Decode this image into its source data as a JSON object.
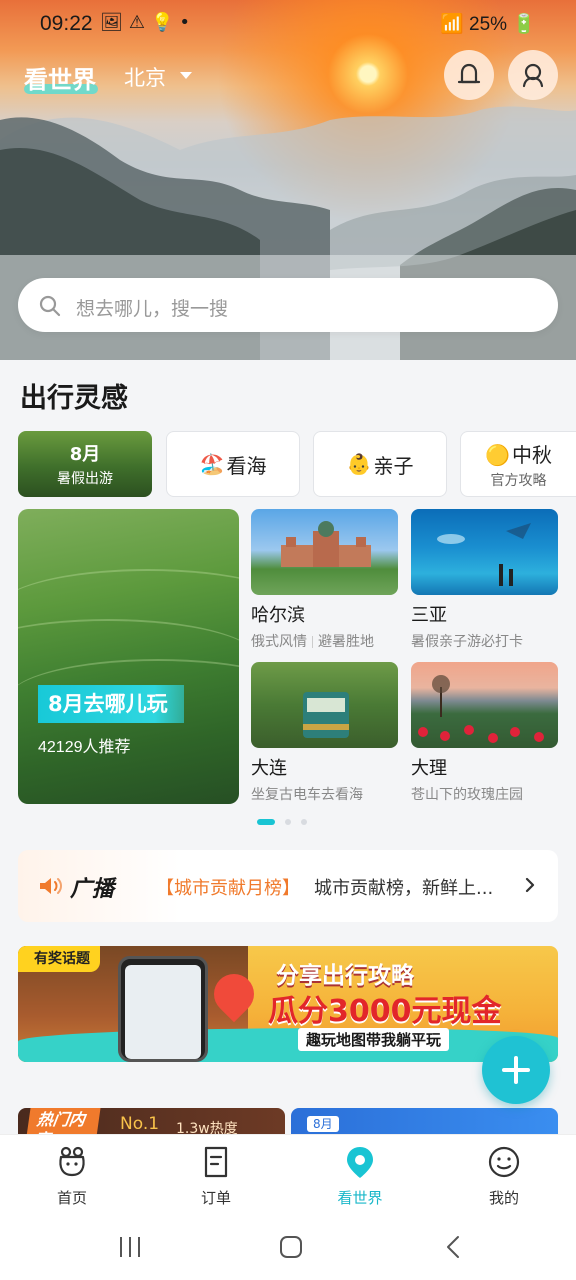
{
  "status_bar": {
    "time": "09:22",
    "battery": "25%"
  },
  "header": {
    "brand": "看世界",
    "city": "北京"
  },
  "search": {
    "placeholder": "想去哪儿，搜一搜"
  },
  "inspiration": {
    "title": "出行灵感",
    "chips": [
      {
        "title": "8月",
        "subtitle": "暑假出游"
      },
      {
        "emoji": "🏖️",
        "title": "看海"
      },
      {
        "emoji": "👶",
        "title": "亲子"
      },
      {
        "emoji": "🟡",
        "title": "中秋",
        "subtitle": "官方攻略"
      }
    ],
    "featured": {
      "tag": "8月去哪儿玩",
      "subtitle": "42129人推荐"
    },
    "destinations": [
      {
        "name": "哈尔滨",
        "desc_a": "俄式风情",
        "desc_b": "避暑胜地"
      },
      {
        "name": "三亚",
        "desc": "暑假亲子游必打卡"
      },
      {
        "name": "大连",
        "desc": "坐复古电车去看海"
      },
      {
        "name": "大理",
        "desc": "苍山下的玫瑰庄园"
      }
    ],
    "pager": {
      "count": 3,
      "active": 1
    }
  },
  "broadcast": {
    "title": "广播",
    "highlight": "【城市贡献月榜】",
    "text": "城市贡献榜，新鲜上..."
  },
  "banner": {
    "tag": "有奖话题",
    "line1": "分享出行攻略",
    "line2": "瓜分3000元现金",
    "line3": "趣玩地图带我躺平玩"
  },
  "feed": [
    {
      "tag": "热门内容",
      "rank": "No.1",
      "heat": "1.3w热度"
    },
    {
      "tag": "8月"
    }
  ],
  "tabbar": [
    {
      "label": "首页",
      "icon": "home-icon"
    },
    {
      "label": "订单",
      "icon": "order-icon"
    },
    {
      "label": "看世界",
      "icon": "location-pin-icon",
      "active": true
    },
    {
      "label": "我的",
      "icon": "profile-icon"
    }
  ],
  "colors": {
    "accent": "#19c4d3",
    "broadcast_highlight": "#f07a2c"
  }
}
